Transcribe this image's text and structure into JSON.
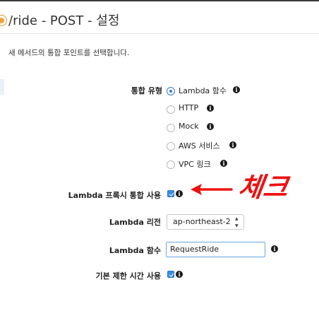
{
  "header": {
    "title": "/ride - POST - 설정"
  },
  "subtitle": "새 메서드의 통합 포인트를 선택합니다.",
  "form": {
    "integration_type_label": "통합 유형",
    "integration_options": [
      {
        "label": "Lambda 함수",
        "selected": true
      },
      {
        "label": "HTTP",
        "selected": false
      },
      {
        "label": "Mock",
        "selected": false
      },
      {
        "label": "AWS 서비스",
        "selected": false
      },
      {
        "label": "VPC 링크",
        "selected": false
      }
    ],
    "proxy_label": "Lambda 프록시 통합 사용",
    "proxy_checked": true,
    "region_label": "Lambda 리전",
    "region_value": "ap-northeast-2",
    "function_label": "Lambda 함수",
    "function_value": "RequestRide",
    "timeout_label": "기본 제한 시간 사용",
    "timeout_checked": true
  },
  "annotation": {
    "text": "체크",
    "color": "#ee1111"
  },
  "icons": {
    "info": "info-icon",
    "arrow": "arrow-left-icon"
  }
}
